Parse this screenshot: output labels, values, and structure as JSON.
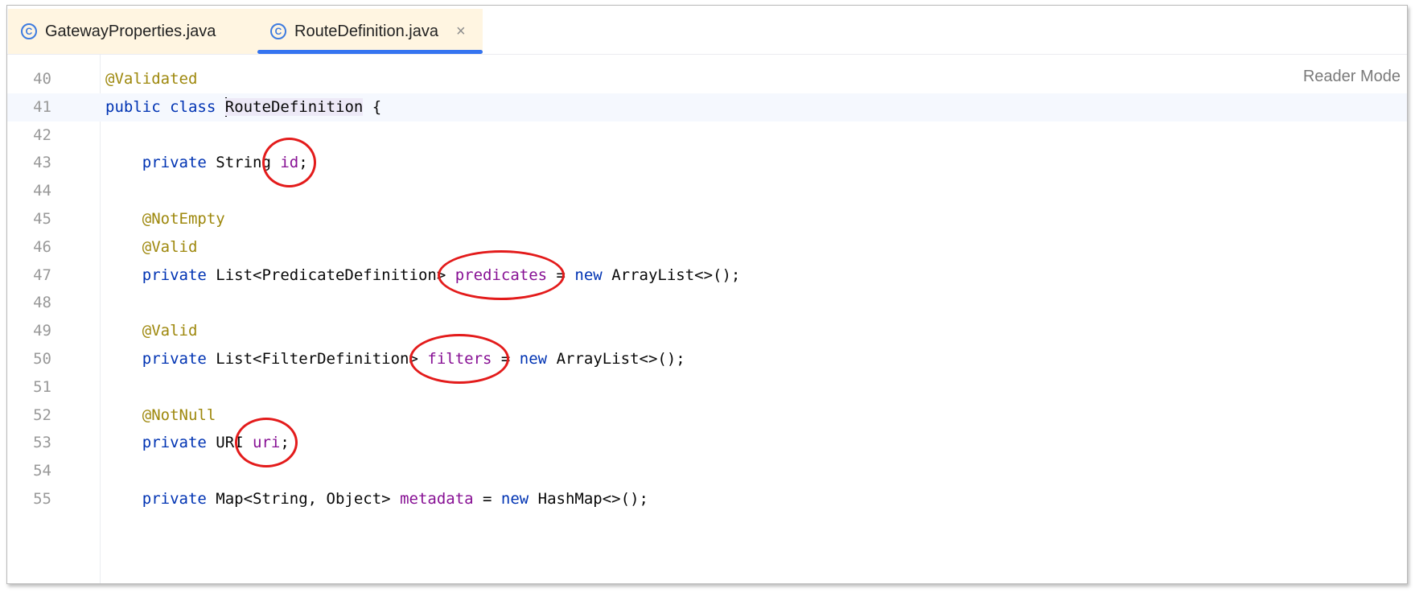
{
  "tabs": [
    {
      "label": "GatewayProperties.java",
      "icon": "class-icon"
    },
    {
      "label": "RouteDefinition.java",
      "icon": "class-icon",
      "active": true
    }
  ],
  "editor": {
    "reader_mode": "Reader Mode",
    "lines": [
      {
        "num": "40",
        "tokens": [
          {
            "t": "@Validated",
            "c": "ann"
          }
        ]
      },
      {
        "num": "41",
        "tokens": [
          {
            "t": "public",
            "c": "kw"
          },
          {
            "t": " "
          },
          {
            "t": "class",
            "c": "kw"
          },
          {
            "t": " "
          },
          {
            "t": "RouteDefinition",
            "c": "cls"
          },
          {
            "t": " {"
          }
        ]
      },
      {
        "num": "42",
        "tokens": []
      },
      {
        "num": "43",
        "tokens": [
          {
            "t": "    "
          },
          {
            "t": "private",
            "c": "kw"
          },
          {
            "t": " String "
          },
          {
            "t": "id",
            "c": "fld"
          },
          {
            "t": ";"
          }
        ]
      },
      {
        "num": "44",
        "tokens": []
      },
      {
        "num": "45",
        "tokens": [
          {
            "t": "    "
          },
          {
            "t": "@NotEmpty",
            "c": "ann"
          }
        ]
      },
      {
        "num": "46",
        "tokens": [
          {
            "t": "    "
          },
          {
            "t": "@Valid",
            "c": "ann"
          }
        ]
      },
      {
        "num": "47",
        "tokens": [
          {
            "t": "    "
          },
          {
            "t": "private",
            "c": "kw"
          },
          {
            "t": " List<PredicateDefinition> "
          },
          {
            "t": "predicates",
            "c": "fld"
          },
          {
            "t": " = "
          },
          {
            "t": "new",
            "c": "kw"
          },
          {
            "t": " ArrayList<>();"
          }
        ]
      },
      {
        "num": "48",
        "tokens": []
      },
      {
        "num": "49",
        "tokens": [
          {
            "t": "    "
          },
          {
            "t": "@Valid",
            "c": "ann"
          }
        ]
      },
      {
        "num": "50",
        "tokens": [
          {
            "t": "    "
          },
          {
            "t": "private",
            "c": "kw"
          },
          {
            "t": " List<FilterDefinition> "
          },
          {
            "t": "filters",
            "c": "fld"
          },
          {
            "t": " = "
          },
          {
            "t": "new",
            "c": "kw"
          },
          {
            "t": " ArrayList<>();"
          }
        ]
      },
      {
        "num": "51",
        "tokens": []
      },
      {
        "num": "52",
        "tokens": [
          {
            "t": "    "
          },
          {
            "t": "@NotNull",
            "c": "ann"
          }
        ]
      },
      {
        "num": "53",
        "tokens": [
          {
            "t": "    "
          },
          {
            "t": "private",
            "c": "kw"
          },
          {
            "t": " URI "
          },
          {
            "t": "uri",
            "c": "fld"
          },
          {
            "t": ";"
          }
        ]
      },
      {
        "num": "54",
        "tokens": []
      },
      {
        "num": "55",
        "tokens": [
          {
            "t": "    "
          },
          {
            "t": "private",
            "c": "kw"
          },
          {
            "t": " Map<String, Object> "
          },
          {
            "t": "metadata",
            "c": "fld"
          },
          {
            "t": " = "
          },
          {
            "t": "new",
            "c": "kw"
          },
          {
            "t": " HashMap<>();"
          }
        ]
      }
    ],
    "current_line": "41",
    "highlighted_fields": [
      "id",
      "predicates",
      "filters",
      "uri"
    ]
  },
  "colors": {
    "keyword": "#0033b3",
    "annotation": "#9e880d",
    "field": "#871094",
    "active_tab_underline": "#3574f0",
    "annotation_circle": "#e31b1b"
  }
}
